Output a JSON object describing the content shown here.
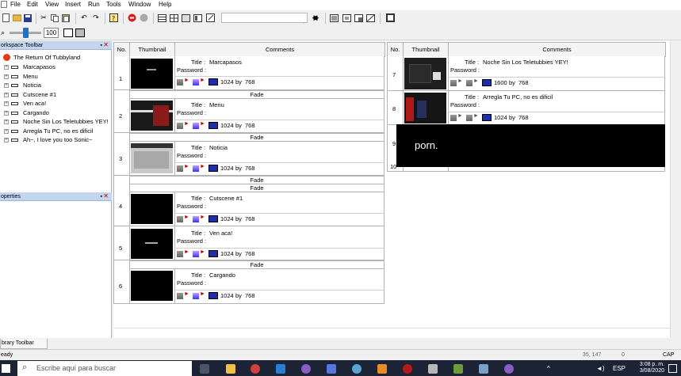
{
  "menu": [
    "File",
    "Edit",
    "View",
    "Insert",
    "Run",
    "Tools",
    "Window",
    "Help"
  ],
  "zoom": "100",
  "workspace": {
    "title": "orkspace Toolbar",
    "root": "The Return Of Tubbyland",
    "items": [
      "Marcapasos",
      "Menu",
      "Noticia",
      "Cutscene #1",
      "Ven aca!",
      "Cargando",
      "Noche Sin Los Teletubbies YEY!",
      "Arregla Tu PC, no es dificil",
      "Ah~, I love you too Sonic~"
    ]
  },
  "properties": {
    "title": "operties"
  },
  "table": {
    "headers": {
      "no": "No.",
      "thumbnail": "Thumbnail",
      "comments": "Comments"
    },
    "title_label": "Title :",
    "password_label": "Password :",
    "by_label": "by",
    "transition": "Fade",
    "left_rows": [
      {
        "no": "1",
        "title": "Marcapasos",
        "w": "1024",
        "h": "768"
      },
      {
        "no": "2",
        "title": "Menu",
        "w": "1024",
        "h": "768"
      },
      {
        "no": "3",
        "title": "Noticia",
        "w": "1024",
        "h": "768"
      },
      {
        "no": "4",
        "title": "Cutscene #1",
        "w": "1024",
        "h": "768"
      },
      {
        "no": "5",
        "title": "Ven aca!",
        "w": "1024",
        "h": "768"
      },
      {
        "no": "6",
        "title": "Cargando",
        "w": "1024",
        "h": "768"
      }
    ],
    "right_rows": [
      {
        "no": "7",
        "title": "Noche Sin Los Teletubbies YEY!",
        "w": "1600",
        "h": "768"
      },
      {
        "no": "8",
        "title": "Arregla Tu PC, no es dificil",
        "w": "1024",
        "h": "768"
      },
      {
        "no": "9"
      },
      {
        "no": "10"
      }
    ]
  },
  "overlay_text": "porn.",
  "library_tab": "brary Toolbar",
  "status": {
    "left": "eady",
    "coords": "35, 147",
    "count": "0",
    "caps": "CAP"
  },
  "taskbar": {
    "search_placeholder": "Escribe aquí para buscar",
    "lang": "ESP",
    "time": "3:08 p. m.",
    "date": "3/08/2020"
  },
  "colors": {
    "panel_header": "#c4d6ee",
    "taskbar": "#1b2334",
    "selection": "#1e6fd0"
  }
}
